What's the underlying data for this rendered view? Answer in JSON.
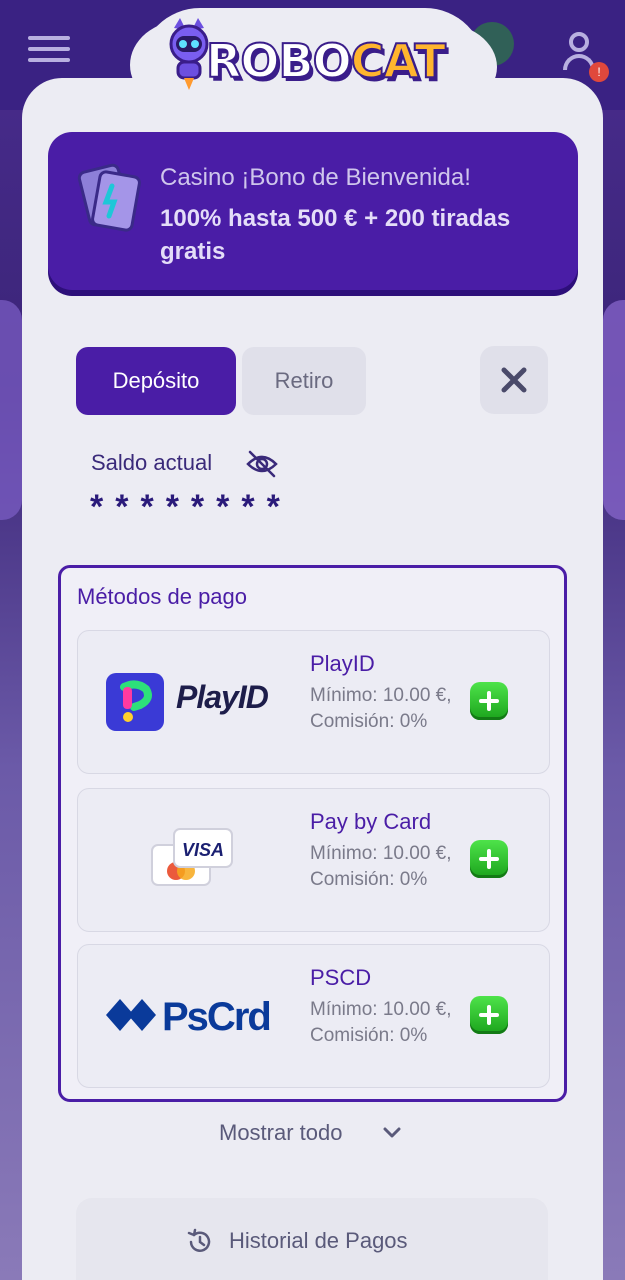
{
  "app": {
    "logo_text_a": "ROBO",
    "logo_text_b": "CAT"
  },
  "promo": {
    "line1": "Casino ¡Bono de Bienvenida!",
    "line2": "100% hasta 500 € + 200 tiradas gratis",
    "icon": "bonus-tickets-icon"
  },
  "tabs": {
    "deposit": "Depósito",
    "withdraw": "Retiro",
    "close_icon": "close-icon"
  },
  "balance": {
    "label": "Saldo actual",
    "value": "********",
    "toggle_icon": "eye-off-icon"
  },
  "methods": {
    "title": "Métodos de pago",
    "items": [
      {
        "name": "PlayID",
        "min": "Mínimo: 10.00 €,",
        "fee": "Comisión: 0%",
        "logo_text": "PlayID"
      },
      {
        "name": "Pay by Card",
        "min": "Mínimo: 10.00 €,",
        "fee": "Comisión: 0%",
        "logo_text": "VISA"
      },
      {
        "name": "PSCD",
        "min": "Mínimo: 10.00 €,",
        "fee": "Comisión: 0%",
        "logo_text": "PsCrd"
      }
    ]
  },
  "show_all": "Mostrar todo",
  "history": "Historial de Pagos",
  "colors": {
    "accent": "#4a1da6",
    "add": "#22b823",
    "text_muted": "#7a7a8a"
  }
}
